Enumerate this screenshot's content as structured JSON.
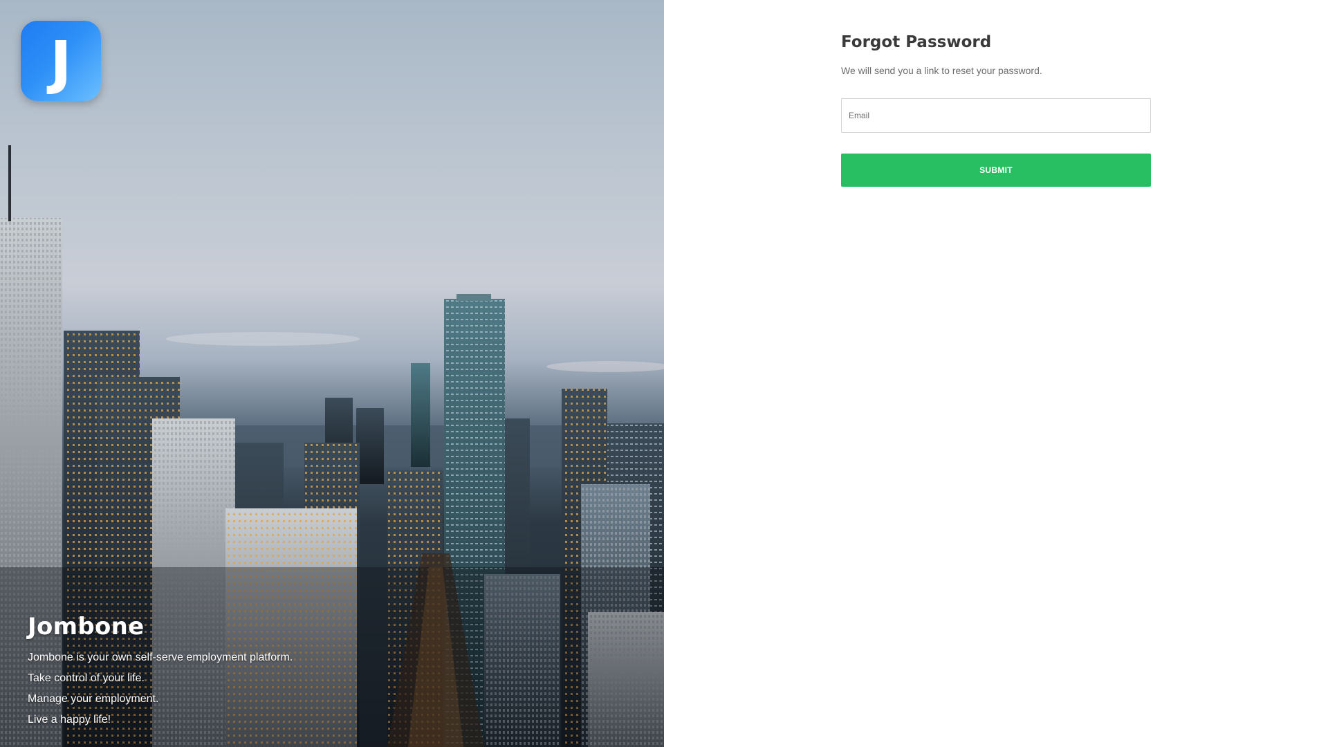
{
  "hero": {
    "logo_letter": "J",
    "brand_name": "Jombone",
    "taglines": [
      "Jombone is your own self-serve employment platform.",
      "Take control of your life.",
      "Manage your employment.",
      "Live a happy life!"
    ]
  },
  "form": {
    "title": "Forgot Password",
    "subtitle": "We will send you a link to reset your password.",
    "email_placeholder": "Email",
    "email_value": "",
    "submit_label": "SUBMIT"
  },
  "colors": {
    "accent_green": "#28bf63",
    "logo_blue": "#2d8ff7"
  },
  "icons": {
    "logo": "jombone-logo-icon"
  }
}
